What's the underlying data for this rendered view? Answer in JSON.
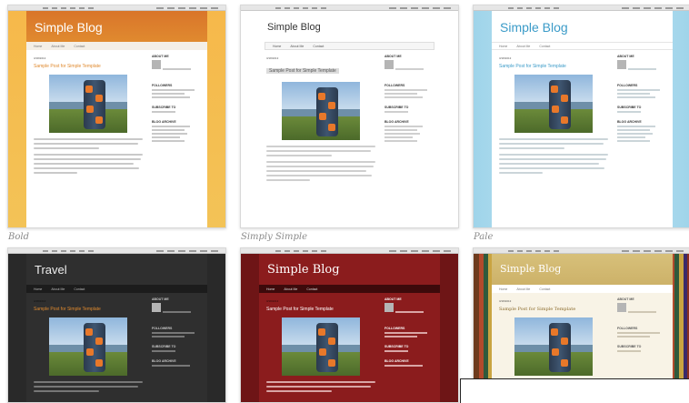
{
  "templates": [
    {
      "key": "bold",
      "caption": "Bold",
      "blog_title": "Simple Blog",
      "tabs": [
        "Home",
        "About Me",
        "Contact"
      ],
      "post_title": "Sample Post for Simple Template",
      "date_label": "3/18/2013",
      "sidebar_headings": [
        "ABOUT ME",
        "FOLLOWERS",
        "SUBSCRIBE TO",
        "BLOG ARCHIVE"
      ]
    },
    {
      "key": "simply-simple",
      "caption": "Simply Simple",
      "blog_title": "Simple Blog",
      "tabs": [
        "Home",
        "About Me",
        "Contact"
      ],
      "post_title": "Sample Post for Simple Template",
      "date_label": "3/18/2013",
      "sidebar_headings": [
        "ABOUT ME",
        "FOLLOWERS",
        "SUBSCRIBE TO",
        "BLOG ARCHIVE"
      ]
    },
    {
      "key": "pale",
      "caption": "Pale",
      "blog_title": "Simple Blog",
      "tabs": [
        "Home",
        "About Me",
        "Contact"
      ],
      "post_title": "Sample Post for Simple Template",
      "date_label": "3/18/2013",
      "sidebar_headings": [
        "ABOUT ME",
        "FOLLOWERS",
        "SUBSCRIBE TO",
        "BLOG ARCHIVE"
      ]
    },
    {
      "key": "travel",
      "caption": "",
      "blog_title": "Travel",
      "tabs": [
        "Home",
        "About Me",
        "Contact"
      ],
      "post_title": "Sample Post for Simple Template",
      "date_label": "3/18/2013",
      "sidebar_headings": [
        "ABOUT ME",
        "FOLLOWERS",
        "SUBSCRIBE TO",
        "BLOG ARCHIVE"
      ]
    },
    {
      "key": "red",
      "caption": "",
      "blog_title": "Simple Blog",
      "tabs": [
        "Home",
        "About Me",
        "Contact"
      ],
      "post_title": "Sample Post for Simple Template",
      "date_label": "3/18/2013",
      "sidebar_headings": [
        "ABOUT ME",
        "FOLLOWERS",
        "SUBSCRIBE TO",
        "BLOG ARCHIVE"
      ]
    },
    {
      "key": "books",
      "caption": "",
      "blog_title": "Simple Blog",
      "tabs": [
        "Home",
        "About Me",
        "Contact"
      ],
      "post_title": "Sample Post for Simple Template",
      "date_label": "3/18/2013",
      "sidebar_headings": [
        "ABOUT ME",
        "FOLLOWERS",
        "SUBSCRIBE TO",
        "BLOG ARCHIVE"
      ]
    }
  ],
  "colors": {
    "bold_header": "#d9752a",
    "pale_title": "#3b9bc8",
    "travel_bg": "#292929",
    "red_bg": "#8b1c1d",
    "books_header": "#cdb269"
  }
}
